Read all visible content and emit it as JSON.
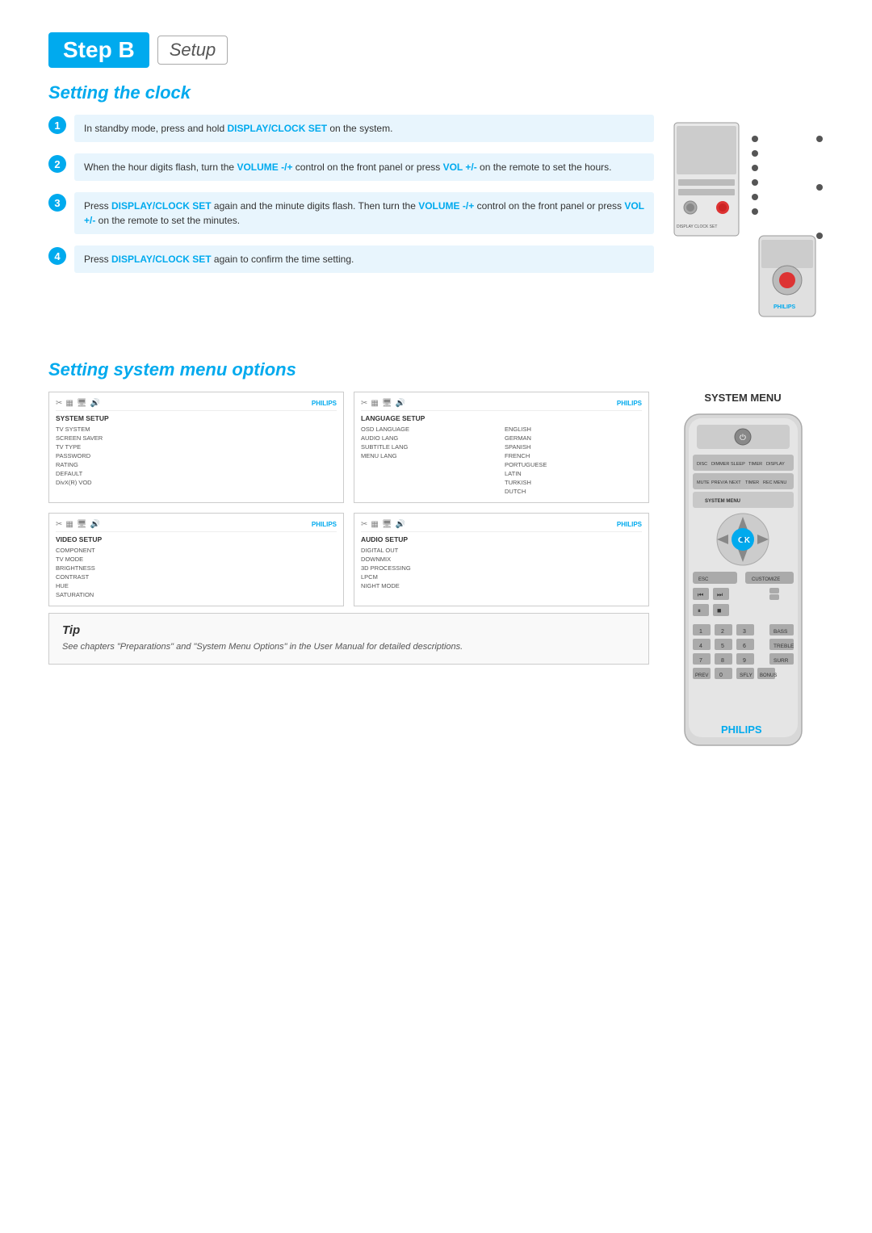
{
  "header": {
    "step_label": "Step B",
    "setup_label": "Setup"
  },
  "clock_section": {
    "title": "Setting the clock",
    "steps": [
      {
        "num": "1",
        "text_parts": [
          {
            "type": "normal",
            "text": "In standby mode, press and hold "
          },
          {
            "type": "bold",
            "text": "DISPLAY/CLOCK SET"
          },
          {
            "type": "normal",
            "text": " on the system."
          }
        ]
      },
      {
        "num": "2",
        "text_parts": [
          {
            "type": "normal",
            "text": "When the hour digits flash, turn the "
          },
          {
            "type": "bold",
            "text": "VOLUME -/+"
          },
          {
            "type": "normal",
            "text": " control on the front panel or press "
          },
          {
            "type": "bold",
            "text": "VOL +/-"
          },
          {
            "type": "normal",
            "text": " on the remote to set the hours."
          }
        ]
      },
      {
        "num": "3",
        "text_parts": [
          {
            "type": "normal",
            "text": "Press "
          },
          {
            "type": "bold",
            "text": "DISPLAY/CLOCK SET"
          },
          {
            "type": "normal",
            "text": " again and the minute digits flash. Then turn the "
          },
          {
            "type": "bold",
            "text": "VOLUME -/+"
          },
          {
            "type": "normal",
            "text": " control on the front panel or press "
          },
          {
            "type": "bold",
            "text": "VOL +/-"
          },
          {
            "type": "normal",
            "text": " on the remote to set the minutes."
          }
        ]
      },
      {
        "num": "4",
        "text_parts": [
          {
            "type": "normal",
            "text": "Press "
          },
          {
            "type": "bold",
            "text": "DISPLAY/CLOCK SET"
          },
          {
            "type": "normal",
            "text": " again to confirm the time setting."
          }
        ]
      }
    ]
  },
  "system_section": {
    "title": "Setting system menu options",
    "system_menu_label": "SYSTEM MENU",
    "menus": [
      {
        "id": "system-setup",
        "section": "SYSTEM SETUP",
        "items": [
          "TV SYSTEM",
          "SCREEN SAVER",
          "TV TYPE",
          "PASSWORD",
          "RATING",
          "DEFAULT",
          "DivX(R) VOD"
        ]
      },
      {
        "id": "language-setup",
        "section": "LANGUAGE SETUP",
        "left_items": [
          "OSD LANGUAGE",
          "AUDIO LANG",
          "SUBTITLE LANG",
          "MENU LANG"
        ],
        "right_items": [
          "ENGLISH",
          "GERMAN",
          "SPANISH",
          "FRENCH",
          "PORTUGUESE",
          "LATIN",
          "TURKISH",
          "DUTCH"
        ]
      },
      {
        "id": "video-setup",
        "section": "VIDEO SETUP",
        "items": [
          "COMPONENT",
          "TV MODE",
          "BRIGHTNESS",
          "CONTRAST",
          "HUE",
          "SATURATION"
        ]
      },
      {
        "id": "audio-setup",
        "section": "AUDIO SETUP",
        "items": [
          "DIGITAL OUT",
          "DOWNMIX",
          "3D PROCESSING",
          "LPCM",
          "NIGHT MODE"
        ]
      }
    ],
    "tip": {
      "title": "Tip",
      "text": "See chapters \"Preparations\" and \"System Menu Options\" in the User Manual for detailed descriptions."
    }
  }
}
